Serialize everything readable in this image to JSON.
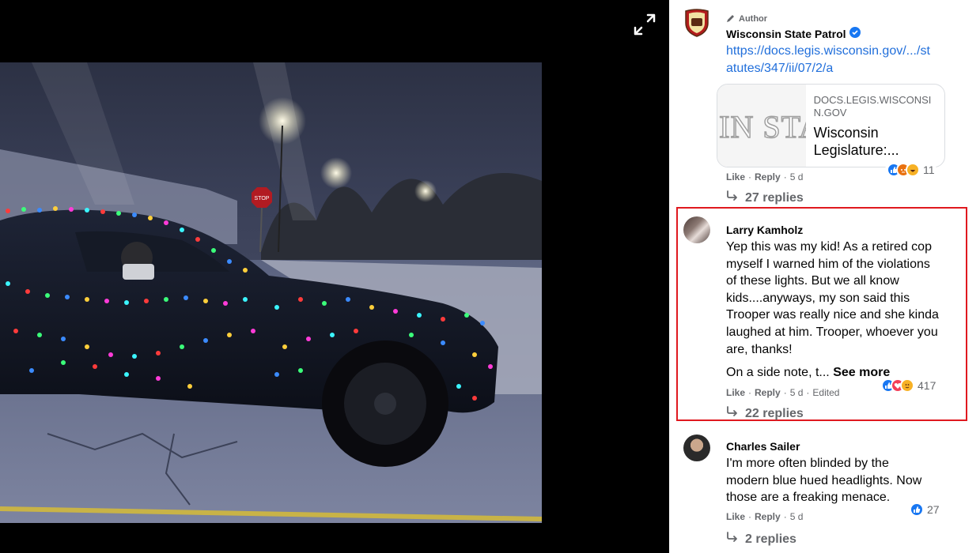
{
  "viewer": {
    "expand_icon": "expand-arrows-icon"
  },
  "comments": [
    {
      "badge": "Author",
      "author": "Wisconsin State Patrol",
      "verified": true,
      "link_text": "https://docs.legis.wisconsin.gov/.../statutes/347/ii/07/2/a",
      "preview": {
        "domain": "DOCS.LEGIS.WISCONSIN.GOV",
        "title": "Wisconsin Legislature:...",
        "image_text": "SIN STA"
      },
      "like": "Like",
      "reply": "Reply",
      "time": "5 d",
      "reaction_count": "11",
      "replies": "27 replies"
    },
    {
      "author": "Larry Kamholz",
      "text": "Yep this was my kid! As a retired cop myself I warned him of the violations of these lights. But we all know kids....anyways, my son said this Trooper was really nice and she kinda laughed at him. Trooper, whoever you are, thanks!",
      "text2": "On a side note, t...",
      "see_more": "See more",
      "like": "Like",
      "reply": "Reply",
      "time": "5 d",
      "edited": "Edited",
      "reaction_count": "417",
      "replies": "22 replies",
      "highlight_color": "#e0191f"
    },
    {
      "author": "Charles Sailer",
      "text": "I'm more often blinded by the modern blue hued headlights. Now those are a freaking menace.",
      "like": "Like",
      "reply": "Reply",
      "time": "5 d",
      "reaction_count": "27",
      "replies": "2 replies"
    }
  ],
  "colors": {
    "like_blue": "#1877f2",
    "love_red": "#f33e58",
    "haha_yellow": "#f7b125",
    "link_blue": "#216fdb"
  }
}
